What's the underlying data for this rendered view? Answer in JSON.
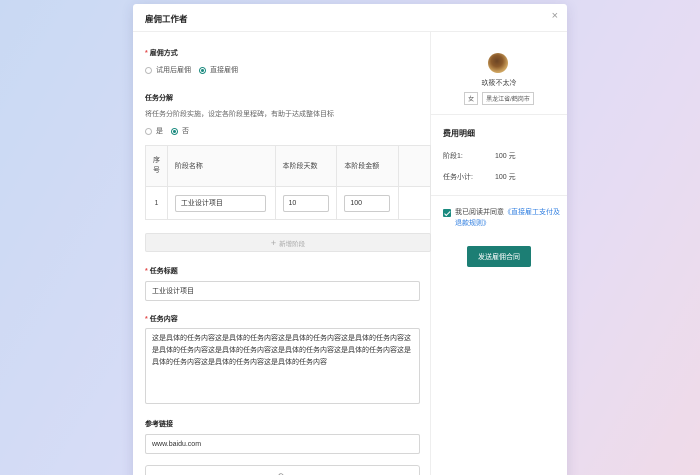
{
  "modal": {
    "title": "雇佣工作者",
    "close_icon": "×"
  },
  "hire_method": {
    "label": "雇佣方式",
    "options": [
      {
        "label": "试用后雇佣",
        "selected": false
      },
      {
        "label": "直接雇佣",
        "selected": true
      }
    ]
  },
  "task_split": {
    "label": "任务分解",
    "hint": "将任务分阶段实施，设定各阶段里程碑，有助于达成整体目标",
    "options": [
      {
        "label": "是",
        "selected": false
      },
      {
        "label": "否",
        "selected": true
      }
    ]
  },
  "stage_table": {
    "headers": [
      "序号",
      "阶段名称",
      "本阶段天数",
      "本阶段金额",
      ""
    ],
    "rows": [
      {
        "index": "1",
        "name": "工业设计项目",
        "days": "10",
        "amount": "100"
      }
    ],
    "add_label": "新增阶段",
    "add_icon": "+"
  },
  "task_title": {
    "label": "任务标题",
    "value": "工业设计项目"
  },
  "task_content": {
    "label": "任务内容",
    "value": "这是具体的任务内容这是具体的任务内容这是具体的任务内容这是具体的任务内容这是具体的任务内容这是具体的任务内容这是具体的任务内容这是具体的任务内容这是具体的任务内容这是具体的任务内容这是具体的任务内容"
  },
  "ref_link": {
    "label": "参考链接",
    "value": "www.baidu.com"
  },
  "upload": {
    "icon": "upload-cloud-icon"
  },
  "worker": {
    "name": "玖筱不太冷",
    "tags": [
      "女",
      "黑龙江省/鹤岗市"
    ]
  },
  "fee": {
    "title": "费用明细",
    "rows": [
      {
        "key": "阶段1:",
        "value": "100 元"
      },
      {
        "key": "任务小计:",
        "value": "100 元"
      }
    ]
  },
  "agreement": {
    "checked": true,
    "text": "我已阅读并同意",
    "link_text": "《直接雇工支付及退款规则》"
  },
  "send_button": "发送雇佣合同",
  "colors": {
    "accent": "#1c7e74",
    "required": "#e34d4d",
    "link": "#2f7ee0"
  }
}
